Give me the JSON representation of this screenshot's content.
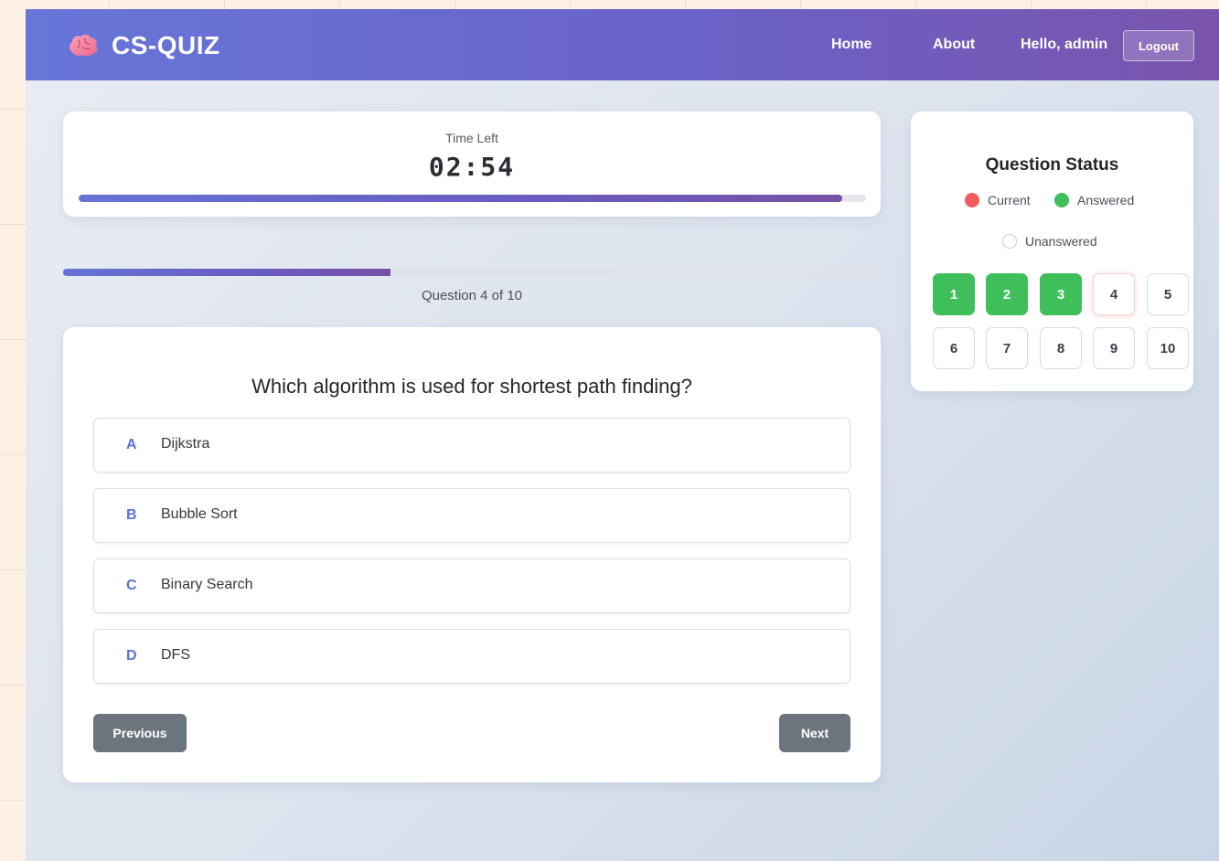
{
  "header": {
    "brand": "CS-QUIZ",
    "nav": {
      "home": "Home",
      "about": "About",
      "greeting": "Hello, admin",
      "logout": "Logout"
    }
  },
  "timer": {
    "label": "Time Left",
    "value": "02:54",
    "progress_fraction": 0.97
  },
  "question_progress": {
    "text": "Question 4 of 10",
    "progress_fraction": 0.4
  },
  "question": {
    "text": "Which algorithm is used for shortest path finding?",
    "options": [
      {
        "letter": "A",
        "text": "Dijkstra"
      },
      {
        "letter": "B",
        "text": "Bubble Sort"
      },
      {
        "letter": "C",
        "text": "Binary Search"
      },
      {
        "letter": "D",
        "text": "DFS"
      }
    ],
    "previous": "Previous",
    "next": "Next"
  },
  "status": {
    "title": "Question Status",
    "legend": {
      "current": "Current",
      "answered": "Answered",
      "unanswered": "Unanswered"
    },
    "questions": [
      {
        "number": "1",
        "state": "answered"
      },
      {
        "number": "2",
        "state": "answered"
      },
      {
        "number": "3",
        "state": "answered"
      },
      {
        "number": "4",
        "state": "current"
      },
      {
        "number": "5",
        "state": "unanswered"
      },
      {
        "number": "6",
        "state": "unanswered"
      },
      {
        "number": "7",
        "state": "unanswered"
      },
      {
        "number": "8",
        "state": "unanswered"
      },
      {
        "number": "9",
        "state": "unanswered"
      },
      {
        "number": "10",
        "state": "unanswered"
      }
    ]
  },
  "colors": {
    "header_start": "#6876d8",
    "header_end": "#7a54ad",
    "accent": "#5872d6",
    "answered": "#3fbf5a",
    "current": "#f25c5c",
    "button_gray": "#6c757d"
  }
}
